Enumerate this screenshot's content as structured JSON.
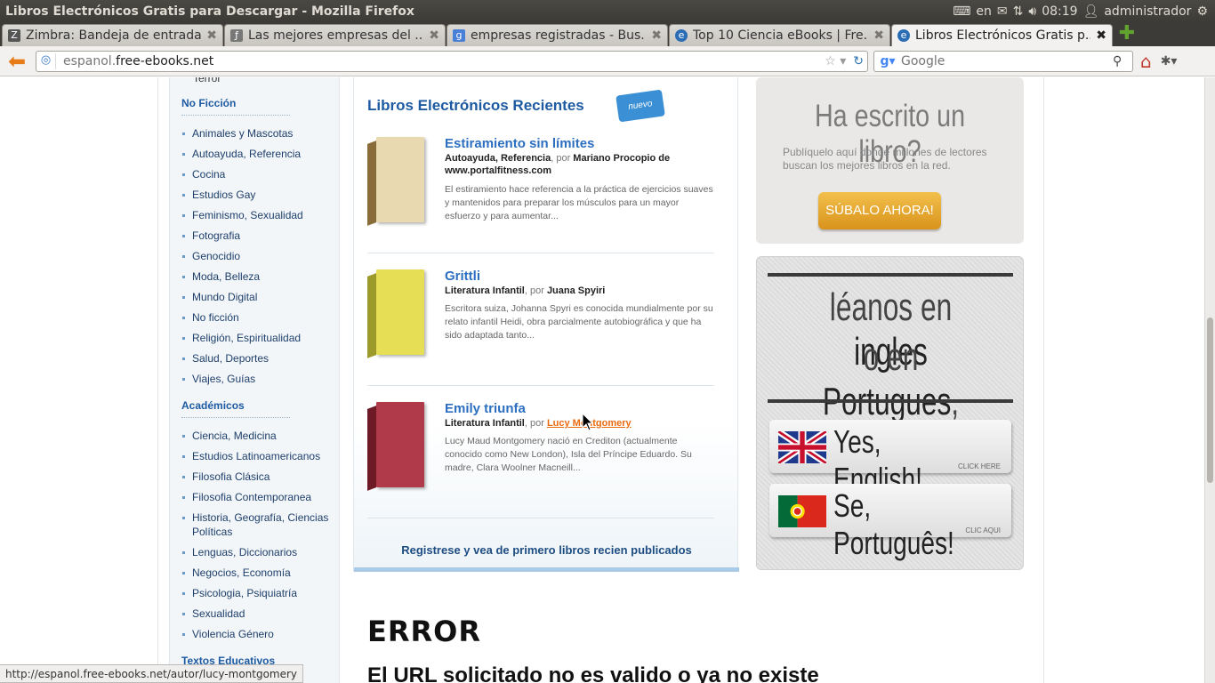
{
  "window": {
    "title": "Libros Electrónicos Gratis para Descargar - Mozilla Firefox",
    "indicators": {
      "keyboard": "en",
      "time": "08:19",
      "user": "administrador"
    }
  },
  "tabs": [
    {
      "label": "Zimbra: Bandeja de entrada",
      "icon": "zimbra-icon",
      "active": false
    },
    {
      "label": "Las mejores empresas del ...",
      "icon": "page-icon",
      "active": false
    },
    {
      "label": "empresas registradas - Bus...",
      "icon": "google-icon",
      "active": false
    },
    {
      "label": "Top 10 Ciencia eBooks | Fre...",
      "icon": "ebooks-icon",
      "active": false
    },
    {
      "label": "Libros Electrónicos Gratis p...",
      "icon": "ebooks-icon",
      "active": true
    }
  ],
  "navbar": {
    "url_prefix": "espanol.",
    "url_domain": "free-ebooks.net",
    "search_placeholder": "Google"
  },
  "sidebar": {
    "truncated_item": "Terror",
    "sections": [
      {
        "heading": "No Ficción",
        "items": [
          "Animales y Mascotas",
          "Autoayuda, Referencia",
          "Cocina",
          "Estudios Gay",
          "Feminismo, Sexualidad",
          "Fotografia",
          "Genocidio",
          "Moda, Belleza",
          "Mundo Digital",
          "No ficción",
          "Religión, Espiritualidad",
          "Salud, Deportes",
          "Viajes, Guías"
        ]
      },
      {
        "heading": "Académicos",
        "items": [
          "Ciencia, Medicina",
          "Estudios Latinoamericanos",
          "Filosofia Clásica",
          "Filosofia Contemporanea",
          "Historia, Geografía, Ciencias Políticas",
          "Lenguas, Diccionarios",
          "Negocios, Economía",
          "Psicologia, Psiquiatría",
          "Sexualidad",
          "Violencia Género"
        ]
      },
      {
        "heading": "Textos Educativos",
        "items": []
      }
    ]
  },
  "recent": {
    "heading": "Libros Electrónicos Recientes",
    "tag": "nuevo",
    "por": "por",
    "books": [
      {
        "title": "Estiramiento sin límites",
        "category": "Autoayuda, Referencia",
        "author": "Mariano Procopio de www.portalfitness.com",
        "description": "El estiramiento hace referencia a la práctica de ejercicios suaves y mantenidos para preparar los músculos para un mayor esfuerzo y para aumentar...",
        "cover_color": "#e9d9b0",
        "spine_color": "#8a6c3b"
      },
      {
        "title": "Grittli",
        "category": "Literatura Infantil",
        "author": "Juana Spyiri",
        "description": "Escritora suiza, Johanna Spyri es conocida mundialmente por su relato infantil Heidi, obra parcialmente autobiográfica y que ha sido adaptada tanto...",
        "cover_color": "#e6df55",
        "spine_color": "#9c9a2a"
      },
      {
        "title": "Emily triunfa",
        "category": "Literatura Infantil",
        "author": "Lucy Montgomery",
        "description": "Lucy Maud Montgomery nació en Crediton (actualmente conocido como New London), Isla del Príncipe Eduardo. Su madre, Clara Woolner Macneill...",
        "cover_color": "#b03a4a",
        "spine_color": "#6e1a26"
      }
    ],
    "register_link": "Registrese y vea de primero libros recien publicados"
  },
  "ads": {
    "write": {
      "headline": "Ha escrito un libro?",
      "body": "Publíquelo aquí donde millones de lectores buscan los mejores libros en la red.",
      "button": "SÚBALO AHORA!"
    },
    "language": {
      "line1_a": "léanos en ",
      "line1_b": "ingles",
      "line2_a": "o en ",
      "line2_b": "Portugues",
      "line2_c": ",",
      "english": "Yes, English!",
      "english_sub": "CLICK HERE",
      "portuguese": "Se, Português!",
      "portuguese_sub": "CLIC AQUI"
    }
  },
  "error": {
    "title": "ERROR",
    "subtitle": "El URL solicitado no es valido o ya no existe"
  },
  "status_url": "http://espanol.free-ebooks.net/autor/lucy-montgomery"
}
